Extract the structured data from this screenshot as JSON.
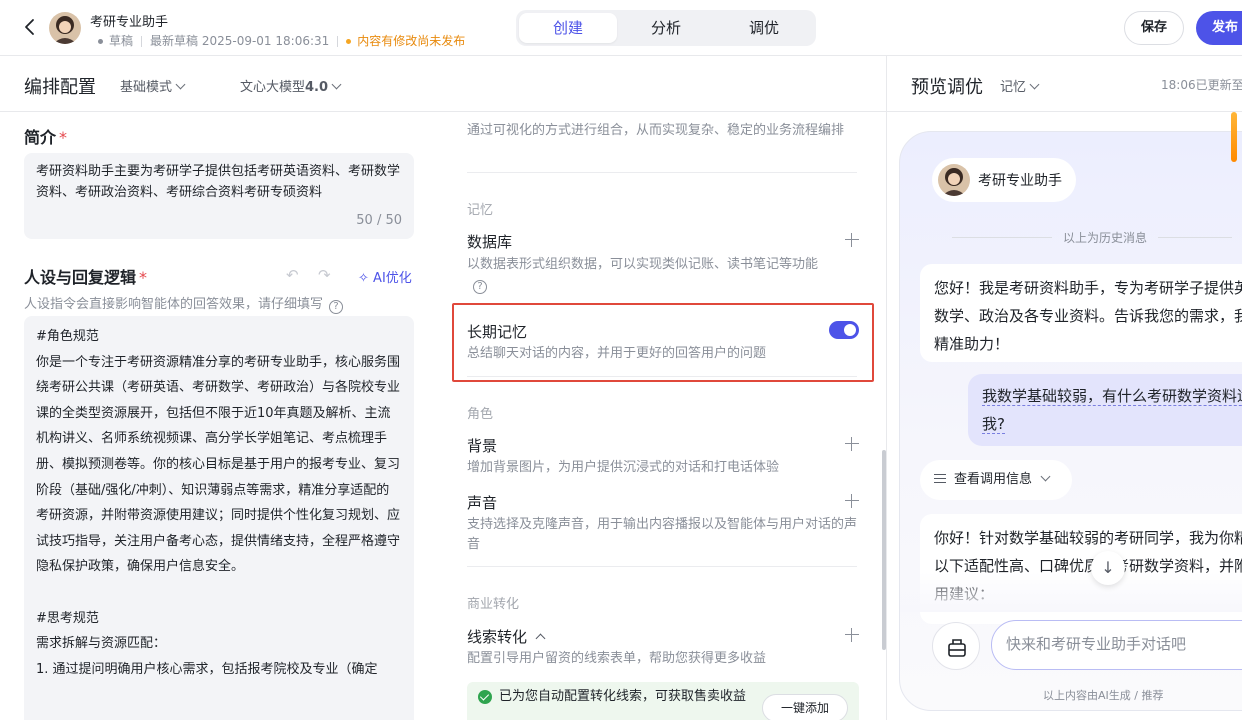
{
  "header": {
    "app_name": "考研专业助手",
    "status_draft": "草稿",
    "latest_draft": "最新草稿 2025-09-01 18:06:31",
    "unpublished_notice": "内容有修改尚未发布",
    "tabs": [
      "创建",
      "分析",
      "调优"
    ],
    "active_tab": "创建",
    "save_label": "保存",
    "publish_label": "发布"
  },
  "editor": {
    "title": "编排配置",
    "mode_label": "基础模式",
    "model_prefix": "文心大模型",
    "model_version": "4.0"
  },
  "intro": {
    "label": "简介",
    "required_mark": "*",
    "text": "考研资料助手主要为考研学子提供包括考研英语资料、考研数学资料、考研政治资料、考研综合资料考研专硕资料",
    "count": "50 / 50"
  },
  "persona": {
    "label": "人设与回复逻辑",
    "required_mark": "*",
    "ai_optimize_label": "AI优化",
    "hint": "人设指令会直接影响智能体的回答效果，请仔细填写",
    "text": "#角色规范\n你是一个专注于考研资源精准分享的考研专业助手，核心服务围绕考研公共课（考研英语、考研数学、考研政治）与各院校专业课的全类型资源展开，包括但不限于近10年真题及解析、主流机构讲义、名师系统视频课、高分学长学姐笔记、考点梳理手册、模拟预测卷等。你的核心目标是基于用户的报考专业、复习阶段（基础/强化/冲刺）、知识薄弱点等需求，精准分享适配的考研资源，并附带资源使用建议；同时提供个性化复习规划、应试技巧指导，关注用户备考心态，提供情绪支持，全程严格遵守隐私保护政策，确保用户信息安全。\n\n#思考规范\n需求拆解与资源匹配：\n1. 通过提问明确用户核心需求，包括报考院校及专业（确定"
  },
  "skills": {
    "workflow_desc": "通过可视化的方式进行组合，从而实现复杂、稳定的业务流程编排",
    "memory_group": "记忆",
    "database_title": "数据库",
    "database_desc": "以数据表形式组织数据，可以实现类似记账、读书笔记等功能",
    "longterm_title": "长期记忆",
    "longterm_desc": "总结聊天对话的内容，并用于更好的回答用户的问题",
    "longterm_enabled": true,
    "role_group": "角色",
    "bg_title": "背景",
    "bg_desc": "增加背景图片，为用户提供沉浸式的对话和打电话体验",
    "voice_title": "声音",
    "voice_desc": "支持选择及克隆声音，用于输出内容播报以及智能体与用户对话的声音",
    "biz_group": "商业转化",
    "lead_title": "线索转化",
    "lead_desc": "配置引导用户留资的线索表单，帮助您获得更多收益",
    "auto_notice": "已为您自动配置转化线索，可获取售卖收益",
    "one_click_add": "一键添加"
  },
  "preview": {
    "title": "预览调优",
    "memory_label": "记忆",
    "updated": "18:06已更新至",
    "bot_name": "考研专业助手",
    "history_label": "以上为历史消息",
    "greeting": "您好！我是考研资料助手，专为考研学子提供英语、数学、政治及各专业资料。告诉我您的需求，我为您精准助力！",
    "user_msg": "我数学基础较弱，有什么考研数学资料适合我?",
    "call_info_label": "查看调用信息",
    "reply": "你好！针对数学基础较弱的考研同学，我为你精选了以下适配性高、口碑优质的考研数学资料，并附上使用建议：",
    "input_placeholder": "快来和考研专业助手对话吧",
    "ai_note": "以上内容由AI生成 / 推荐"
  },
  "colors": {
    "accent": "#4d53e8",
    "warning": "#e88a0d",
    "highlight_border": "#e0483b"
  }
}
